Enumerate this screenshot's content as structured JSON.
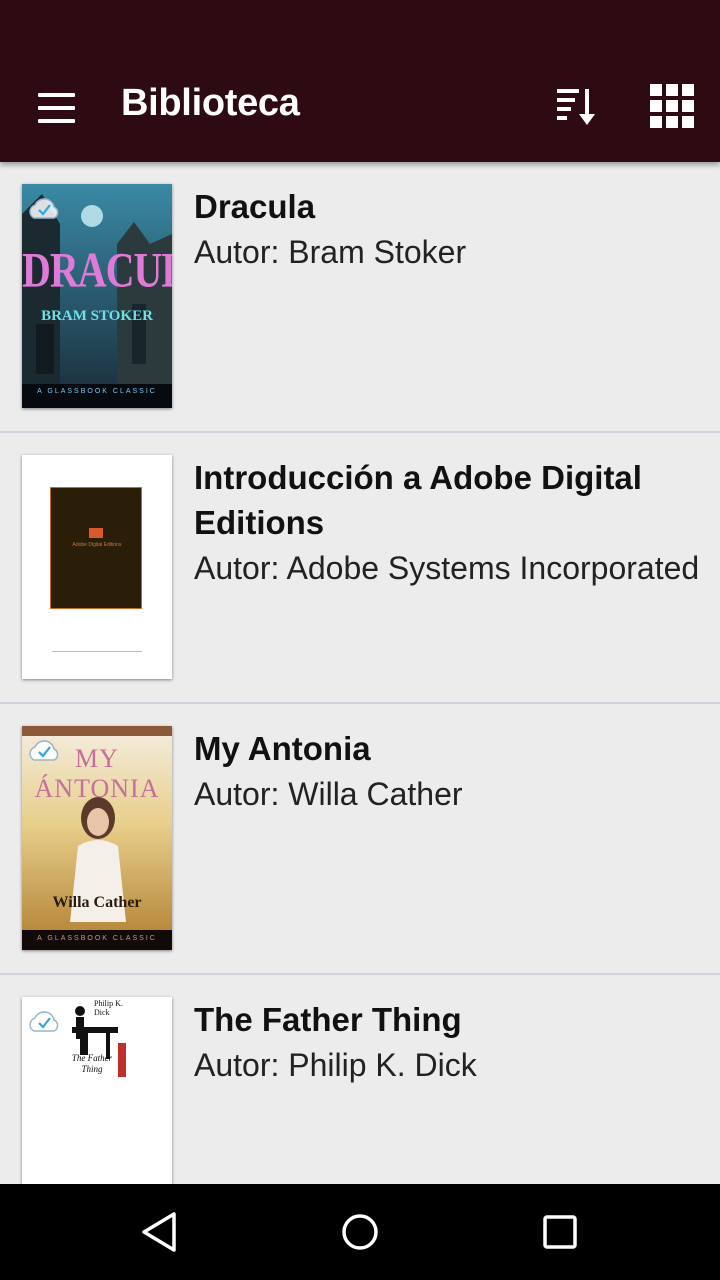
{
  "appbar": {
    "title": "Biblioteca"
  },
  "books": [
    {
      "title": "Dracula",
      "author": "Autor: Bram Stoker",
      "cover": {
        "title": "DRACULA",
        "author": "BRAM STOKER",
        "series": "A GLASSBOOK CLASSIC"
      }
    },
    {
      "title": "Introducción a Adobe Digital Editions",
      "author": "Autor: Adobe Systems Incorporated",
      "cover": {
        "title": "Adobe Digital Editions"
      }
    },
    {
      "title": "My Antonia",
      "author": "Autor: Willa Cather",
      "cover": {
        "title": "MY ÁNTONIA",
        "author": "Willa Cather",
        "series": "A GLASSBOOK CLASSIC"
      }
    },
    {
      "title": "The Father Thing",
      "author": "Autor: Philip K. Dick",
      "cover": {
        "title": "The Father Thing",
        "author": "Philip K. Dick"
      }
    }
  ],
  "colors": {
    "appbar": "#2e0b12",
    "background": "#ececec",
    "divider": "#d2d2da",
    "navbar": "#000000"
  },
  "icons": {
    "menu": "hamburger-menu-icon",
    "sort": "sort-icon",
    "grid": "grid-view-icon",
    "cloud": "cloud-check-icon",
    "back": "back-triangle-icon",
    "home": "home-circle-icon",
    "recents": "recents-square-icon"
  }
}
